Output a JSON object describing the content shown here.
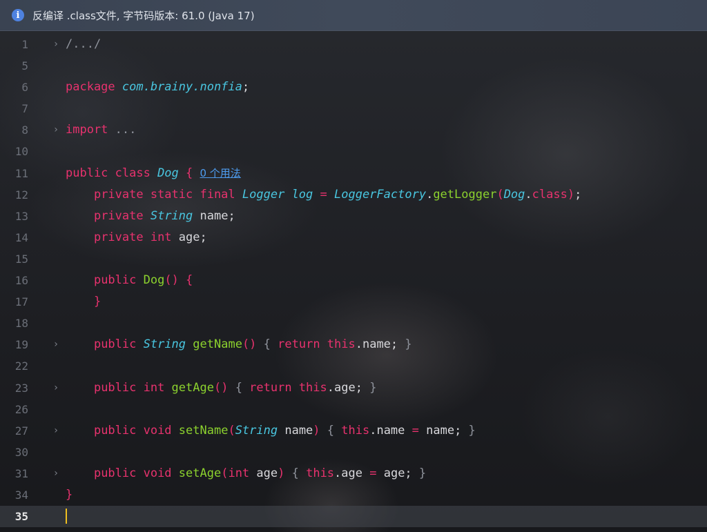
{
  "banner": {
    "icon": "info-icon",
    "text": "反编译 .class文件, 字节码版本: 61.0 (Java 17)"
  },
  "colors": {
    "keyword": "#e8326e",
    "type": "#49c6e0",
    "function": "#8cd22e",
    "plain": "#d8d8dc",
    "caret": "#f0c020",
    "link": "#4e9df0"
  },
  "editor": {
    "current_line": "35",
    "lines": [
      {
        "num": "1",
        "fold": true,
        "tokens": [
          {
            "t": "dim",
            "v": "/.../"
          }
        ]
      },
      {
        "num": "5",
        "fold": false,
        "tokens": []
      },
      {
        "num": "6",
        "fold": false,
        "tokens": [
          {
            "t": "kw",
            "v": "package "
          },
          {
            "t": "ty",
            "v": "com.brainy.nonfia"
          },
          {
            "t": "pl",
            "v": ";"
          }
        ]
      },
      {
        "num": "7",
        "fold": false,
        "tokens": []
      },
      {
        "num": "8",
        "fold": true,
        "tokens": [
          {
            "t": "kw",
            "v": "import "
          },
          {
            "t": "dim",
            "v": "..."
          }
        ]
      },
      {
        "num": "10",
        "fold": false,
        "tokens": []
      },
      {
        "num": "11",
        "fold": false,
        "tokens": [
          {
            "t": "kw",
            "v": "public class "
          },
          {
            "t": "ty",
            "v": "Dog"
          },
          {
            "t": "kw",
            "v": " { "
          }
        ],
        "usage": "0 个用法"
      },
      {
        "num": "12",
        "fold": false,
        "tokens": [
          {
            "t": "pl",
            "v": "    "
          },
          {
            "t": "kw",
            "v": "private static final "
          },
          {
            "t": "ty",
            "v": "Logger"
          },
          {
            "t": "pl",
            "v": " "
          },
          {
            "t": "ty",
            "v": "log"
          },
          {
            "t": "op",
            "v": " = "
          },
          {
            "t": "ty",
            "v": "LoggerFactory"
          },
          {
            "t": "pl",
            "v": "."
          },
          {
            "t": "fn",
            "v": "getLogger"
          },
          {
            "t": "op",
            "v": "("
          },
          {
            "t": "ty",
            "v": "Dog"
          },
          {
            "t": "pl",
            "v": "."
          },
          {
            "t": "kw",
            "v": "class"
          },
          {
            "t": "op",
            "v": ")"
          },
          {
            "t": "pl",
            "v": ";"
          }
        ]
      },
      {
        "num": "13",
        "fold": false,
        "tokens": [
          {
            "t": "pl",
            "v": "    "
          },
          {
            "t": "kw",
            "v": "private "
          },
          {
            "t": "ty",
            "v": "String"
          },
          {
            "t": "pl",
            "v": " name;"
          }
        ]
      },
      {
        "num": "14",
        "fold": false,
        "tokens": [
          {
            "t": "pl",
            "v": "    "
          },
          {
            "t": "kw",
            "v": "private int "
          },
          {
            "t": "pl",
            "v": "age;"
          }
        ]
      },
      {
        "num": "15",
        "fold": false,
        "tokens": []
      },
      {
        "num": "16",
        "fold": false,
        "tokens": [
          {
            "t": "pl",
            "v": "    "
          },
          {
            "t": "kw",
            "v": "public "
          },
          {
            "t": "fn",
            "v": "Dog"
          },
          {
            "t": "op",
            "v": "() {"
          }
        ]
      },
      {
        "num": "17",
        "fold": false,
        "tokens": [
          {
            "t": "pl",
            "v": "    "
          },
          {
            "t": "op",
            "v": "}"
          }
        ]
      },
      {
        "num": "18",
        "fold": false,
        "tokens": []
      },
      {
        "num": "19",
        "fold": true,
        "tokens": [
          {
            "t": "pl",
            "v": "    "
          },
          {
            "t": "kw",
            "v": "public "
          },
          {
            "t": "ty",
            "v": "String"
          },
          {
            "t": "pl",
            "v": " "
          },
          {
            "t": "fn",
            "v": "getName"
          },
          {
            "t": "op",
            "v": "()"
          },
          {
            "t": "dim",
            "v": " { "
          },
          {
            "t": "kw",
            "v": "return this"
          },
          {
            "t": "pl",
            "v": ".name;"
          },
          {
            "t": "dim",
            "v": " }"
          }
        ]
      },
      {
        "num": "22",
        "fold": false,
        "tokens": []
      },
      {
        "num": "23",
        "fold": true,
        "tokens": [
          {
            "t": "pl",
            "v": "    "
          },
          {
            "t": "kw",
            "v": "public int "
          },
          {
            "t": "fn",
            "v": "getAge"
          },
          {
            "t": "op",
            "v": "()"
          },
          {
            "t": "dim",
            "v": " { "
          },
          {
            "t": "kw",
            "v": "return this"
          },
          {
            "t": "pl",
            "v": ".age;"
          },
          {
            "t": "dim",
            "v": " }"
          }
        ]
      },
      {
        "num": "26",
        "fold": false,
        "tokens": []
      },
      {
        "num": "27",
        "fold": true,
        "tokens": [
          {
            "t": "pl",
            "v": "    "
          },
          {
            "t": "kw",
            "v": "public void "
          },
          {
            "t": "fn",
            "v": "setName"
          },
          {
            "t": "op",
            "v": "("
          },
          {
            "t": "ty",
            "v": "String"
          },
          {
            "t": "pl",
            "v": " name"
          },
          {
            "t": "op",
            "v": ")"
          },
          {
            "t": "dim",
            "v": " { "
          },
          {
            "t": "kw",
            "v": "this"
          },
          {
            "t": "pl",
            "v": ".name "
          },
          {
            "t": "op",
            "v": "="
          },
          {
            "t": "pl",
            "v": " name;"
          },
          {
            "t": "dim",
            "v": " }"
          }
        ]
      },
      {
        "num": "30",
        "fold": false,
        "tokens": []
      },
      {
        "num": "31",
        "fold": true,
        "tokens": [
          {
            "t": "pl",
            "v": "    "
          },
          {
            "t": "kw",
            "v": "public void "
          },
          {
            "t": "fn",
            "v": "setAge"
          },
          {
            "t": "op",
            "v": "("
          },
          {
            "t": "kw",
            "v": "int "
          },
          {
            "t": "pl",
            "v": "age"
          },
          {
            "t": "op",
            "v": ")"
          },
          {
            "t": "dim",
            "v": " { "
          },
          {
            "t": "kw",
            "v": "this"
          },
          {
            "t": "pl",
            "v": ".age "
          },
          {
            "t": "op",
            "v": "="
          },
          {
            "t": "pl",
            "v": " age;"
          },
          {
            "t": "dim",
            "v": " }"
          }
        ]
      },
      {
        "num": "34",
        "fold": false,
        "tokens": [
          {
            "t": "op",
            "v": "}"
          }
        ]
      },
      {
        "num": "35",
        "fold": false,
        "tokens": [],
        "caret": true
      }
    ]
  }
}
